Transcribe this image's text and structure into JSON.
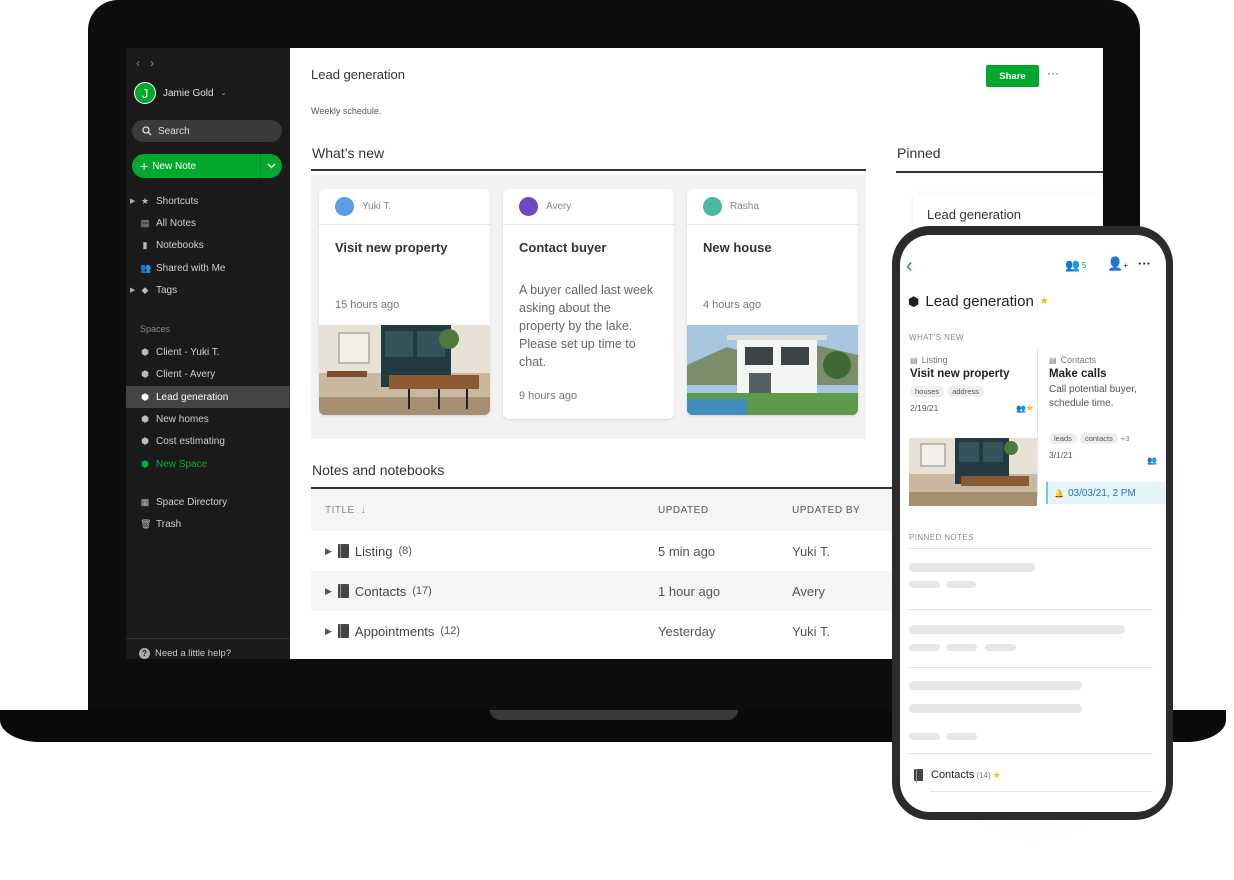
{
  "colors": {
    "accent": "#00a82d",
    "sidebar_bg": "#1a1a1a",
    "star": "#f0c000",
    "reminder": "#1a7bbf"
  },
  "sidebar": {
    "user": {
      "initial": "J",
      "name": "Jamie Gold"
    },
    "search_placeholder": "Search",
    "new_note_label": "New Note",
    "items": [
      {
        "label": "Shortcuts",
        "icon": "star-icon"
      },
      {
        "label": "All Notes",
        "icon": "note-icon"
      },
      {
        "label": "Notebooks",
        "icon": "notebook-icon"
      },
      {
        "label": "Shared with Me",
        "icon": "people-icon"
      },
      {
        "label": "Tags",
        "icon": "tag-icon"
      }
    ],
    "spaces_heading": "Spaces",
    "spaces": [
      {
        "label": "Client - Yuki T."
      },
      {
        "label": "Client - Avery"
      },
      {
        "label": "Lead generation"
      },
      {
        "label": "New homes"
      },
      {
        "label": "Cost estimating"
      },
      {
        "label": "New Space"
      }
    ],
    "bottom_items": [
      {
        "label": "Space Directory",
        "icon": "directory-icon"
      },
      {
        "label": "Trash",
        "icon": "trash-icon"
      }
    ],
    "help_label": "Need a little help?"
  },
  "main": {
    "title": "Lead generation",
    "share_label": "Share",
    "description": "Weekly schedule.",
    "whats_new_title": "What’s new",
    "pinned_title": "Pinned",
    "pinned_card": "Lead generation",
    "cards": [
      {
        "author": "Yuki T.",
        "title": "Visit new property",
        "body": "",
        "time": "15 hours ago",
        "dot_color": "#5b9ee6"
      },
      {
        "author": "Avery",
        "title": "Contact buyer",
        "body": "A buyer called last week asking about the property by the lake. Please set up time to chat.",
        "time": "9 hours ago",
        "dot_color": "#6a4bc4"
      },
      {
        "author": "Rasha",
        "title": "New house",
        "body": "",
        "time": "4 hours ago",
        "dot_color": "#4ab9a3"
      }
    ],
    "notes_title": "Notes and notebooks",
    "columns": {
      "title": "TITLE",
      "updated": "UPDATED",
      "updated_by": "UPDATED BY"
    },
    "rows": [
      {
        "name": "Listing",
        "count": "(8)",
        "updated": "5 min ago",
        "by": "Yuki T."
      },
      {
        "name": "Contacts",
        "count": "(17)",
        "updated": "1 hour ago",
        "by": "Avery"
      },
      {
        "name": "Appointments",
        "count": "(12)",
        "updated": "Yesterday",
        "by": "Yuki T."
      }
    ]
  },
  "phone": {
    "share_count": "5",
    "title": "Lead generation",
    "whats_new_label": "WHAT’S NEW",
    "card1": {
      "kind": "Listing",
      "title": "Visit new property",
      "tags": [
        "houses",
        "address"
      ],
      "date": "2/19/21"
    },
    "card2": {
      "kind": "Contacts",
      "title": "Make calls",
      "body": "Call potential buyer, schedule time.",
      "tags": [
        "leads",
        "contacts"
      ],
      "more_tags": "+3",
      "date": "3/1/21",
      "reminder": "03/03/21, 2 PM"
    },
    "pinned_label": "PINNED NOTES",
    "notebook": {
      "name": "Contacts",
      "count": "(14)"
    }
  }
}
